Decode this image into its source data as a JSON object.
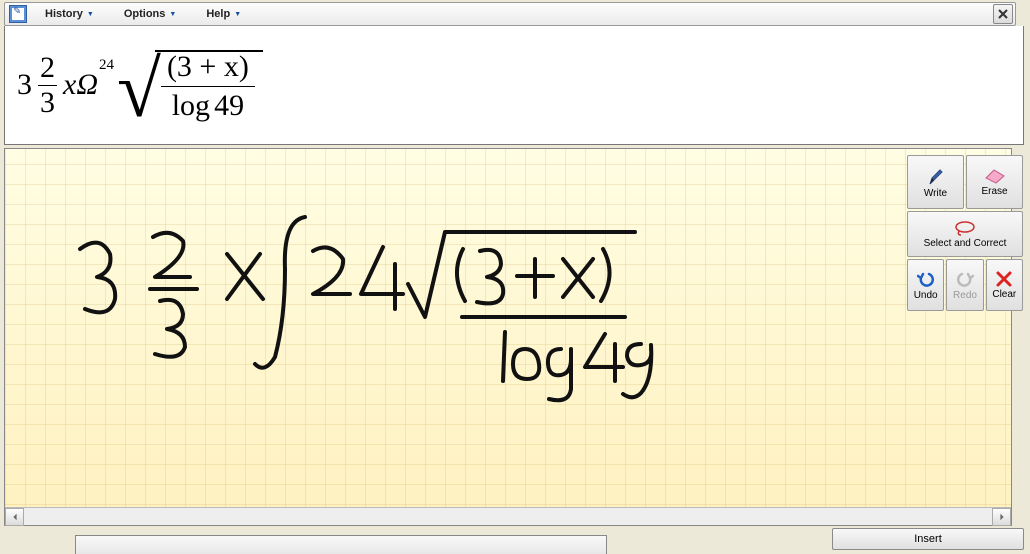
{
  "menu": {
    "history_label": "History",
    "options_label": "Options",
    "help_label": "Help"
  },
  "rendered_math": {
    "coeff": "3",
    "frac_num": "2",
    "frac_den": "3",
    "var": "x",
    "omega": "Ω",
    "root_index": "24",
    "radicand_num": "(3 + x)",
    "radicand_den_log": "log",
    "radicand_den_val": "49"
  },
  "handwritten_math": {
    "expression_description": "3  2/3  x  ∫ 24 √((3+x)/(log 49))"
  },
  "tools": {
    "write_label": "Write",
    "erase_label": "Erase",
    "select_correct_label": "Select and Correct",
    "undo_label": "Undo",
    "redo_label": "Redo",
    "clear_label": "Clear"
  },
  "bottom": {
    "insert_label": "Insert"
  }
}
